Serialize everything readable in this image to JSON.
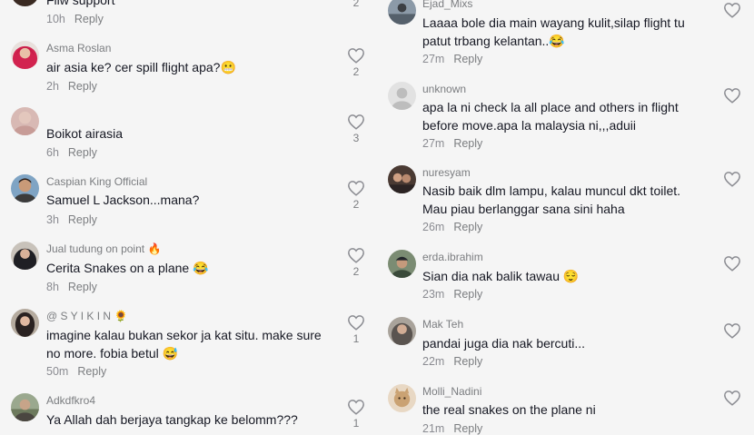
{
  "left_comments": [
    {
      "username": "",
      "text": "Fiiw support",
      "time": "10h",
      "reply": "Reply",
      "likes": "2",
      "avatar": "avatar-dark"
    },
    {
      "username": "Asma Roslan",
      "text": "air asia ke? cer spill flight apa?",
      "text_emoji": "😬",
      "time": "2h",
      "reply": "Reply",
      "likes": "2",
      "avatar": "avatar-hijab-pink"
    },
    {
      "username": "",
      "text": "Boikot airasia",
      "time": "6h",
      "reply": "Reply",
      "likes": "3",
      "avatar": "avatar-pink"
    },
    {
      "username": "Caspian King Official",
      "text": "Samuel L Jackson...mana?",
      "time": "3h",
      "reply": "Reply",
      "likes": "2",
      "avatar": "avatar-man"
    },
    {
      "username": "Jual tudung on point",
      "username_emoji": "🔥",
      "text": "Cerita Snakes on a plane",
      "text_emoji": "😂",
      "time": "8h",
      "reply": "Reply",
      "likes": "2",
      "avatar": "avatar-hijab-dark"
    },
    {
      "username": "@ S Y I K I N",
      "username_emoji": "🌻",
      "text": "imagine kalau bukan sekor ja kat situ. make sure\nno more. fobia betul",
      "text_emoji": "😅",
      "time": "50m",
      "reply": "Reply",
      "likes": "1",
      "avatar": "avatar-girl"
    },
    {
      "username": "Adkdfkro4",
      "text": "Ya Allah dah berjaya tangkap ke belomm???",
      "time": "",
      "reply": "",
      "likes": "1",
      "avatar": "avatar-outdoor"
    }
  ],
  "right_comments": [
    {
      "username": "Ejad_Mixs",
      "text": "Laaaa bole dia main wayang kulit,silap flight tu\npatut trbang kelantan..",
      "text_emoji": "😂",
      "time": "27m",
      "reply": "Reply",
      "avatar": "avatar-outdoor2"
    },
    {
      "username": "unknown",
      "text": "apa la ni check la all place and others in flight\nbefore move.apa la malaysia ni,,,aduii",
      "time": "27m",
      "reply": "Reply",
      "avatar": "avatar-default"
    },
    {
      "username": "nuresyam",
      "text": "Nasib baik dlm lampu, kalau muncul dkt toilet.\nMau piau berlanggar sana sini haha",
      "time": "26m",
      "reply": "Reply",
      "avatar": "avatar-couple"
    },
    {
      "username": "erda.ibrahim",
      "text": "Sian dia nak balik tawau",
      "text_emoji": "😌",
      "time": "23m",
      "reply": "Reply",
      "avatar": "avatar-cap"
    },
    {
      "username": "Mak Teh",
      "text": "pandai juga dia nak bercuti...",
      "time": "22m",
      "reply": "Reply",
      "avatar": "avatar-hijab-grey"
    },
    {
      "username": "Molli_Nadini",
      "text": "the real snakes on the plane ni",
      "time": "21m",
      "reply": "Reply",
      "avatar": "avatar-cat"
    }
  ],
  "colors": {
    "background": "#f5f5f5",
    "text": "#161823",
    "secondary": "#8a8b91",
    "icon": "#8a8b91"
  }
}
